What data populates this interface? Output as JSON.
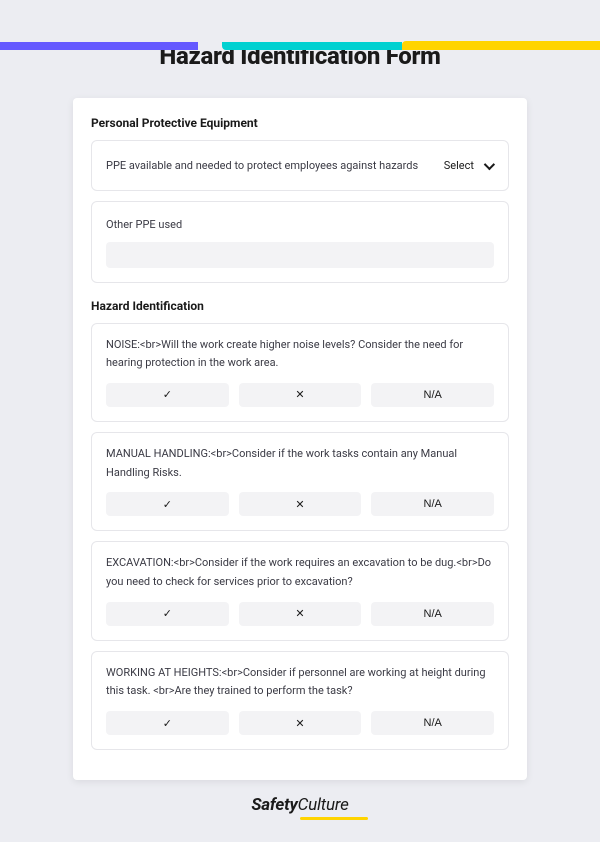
{
  "page": {
    "title": "Hazard Identification Form"
  },
  "sections": {
    "ppe": {
      "heading": "Personal Protective Equipment",
      "field1": {
        "label": "PPE available and needed to protect employees against hazards",
        "select_label": "Select"
      },
      "field2": {
        "label": "Other PPE used"
      }
    },
    "hazard": {
      "heading": "Hazard Identification",
      "questions": [
        "NOISE:<br>Will the work create higher noise levels? Consider the need for hearing protection in the work area.",
        "MANUAL HANDLING:<br>Consider if the work tasks contain any Manual Handling Risks.",
        "EXCAVATION:<br>Consider if the work requires an excavation to be dug.<br>Do you need to check for services prior to excavation?",
        "WORKING AT HEIGHTS:<br>Consider if personnel are working at height during this task. <br>Are they trained to perform the task?"
      ],
      "answers": {
        "yes": "✓",
        "no": "✕",
        "na": "N/A"
      }
    }
  },
  "footer": {
    "brand_bold": "Safety",
    "brand_light": "Culture"
  }
}
